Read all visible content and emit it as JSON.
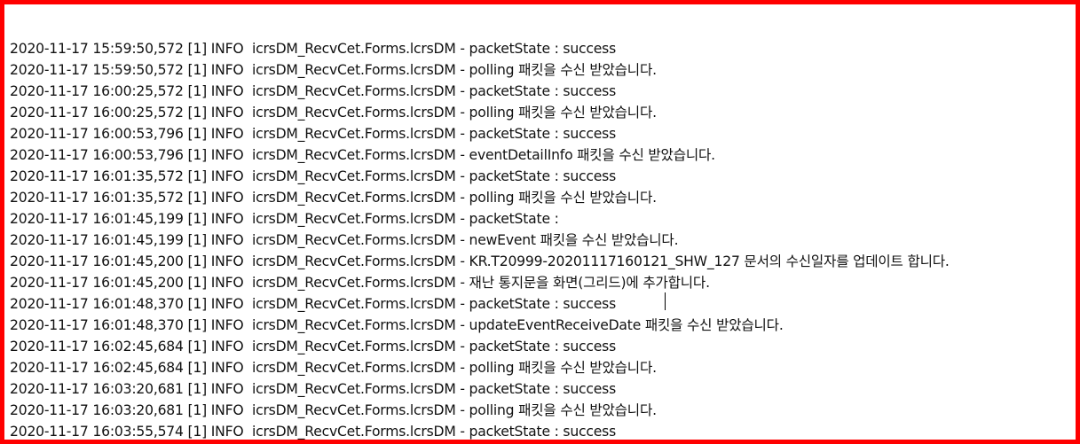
{
  "log": {
    "lines": [
      "2020-11-17 15:59:50,572 [1] INFO  icrsDM_RecvCet.Forms.lcrsDM - packetState : success",
      "2020-11-17 15:59:50,572 [1] INFO  icrsDM_RecvCet.Forms.lcrsDM - polling 패킷을 수신 받았습니다.",
      "2020-11-17 16:00:25,572 [1] INFO  icrsDM_RecvCet.Forms.lcrsDM - packetState : success",
      "2020-11-17 16:00:25,572 [1] INFO  icrsDM_RecvCet.Forms.lcrsDM - polling 패킷을 수신 받았습니다.",
      "2020-11-17 16:00:53,796 [1] INFO  icrsDM_RecvCet.Forms.lcrsDM - packetState : success",
      "2020-11-17 16:00:53,796 [1] INFO  icrsDM_RecvCet.Forms.lcrsDM - eventDetailInfo 패킷을 수신 받았습니다.",
      "2020-11-17 16:01:35,572 [1] INFO  icrsDM_RecvCet.Forms.lcrsDM - packetState : success",
      "2020-11-17 16:01:35,572 [1] INFO  icrsDM_RecvCet.Forms.lcrsDM - polling 패킷을 수신 받았습니다.",
      "2020-11-17 16:01:45,199 [1] INFO  icrsDM_RecvCet.Forms.lcrsDM - packetState :",
      "2020-11-17 16:01:45,199 [1] INFO  icrsDM_RecvCet.Forms.lcrsDM - newEvent 패킷을 수신 받았습니다.",
      "2020-11-17 16:01:45,200 [1] INFO  icrsDM_RecvCet.Forms.lcrsDM - KR.T20999-20201117160121_SHW_127 문서의 수신일자를 업데이트 합니다.",
      "2020-11-17 16:01:45,200 [1] INFO  icrsDM_RecvCet.Forms.lcrsDM - 재난 통지문을 화면(그리드)에 추가합니다.",
      "2020-11-17 16:01:48,370 [1] INFO  icrsDM_RecvCet.Forms.lcrsDM - packetState : success",
      "2020-11-17 16:01:48,370 [1] INFO  icrsDM_RecvCet.Forms.lcrsDM - updateEventReceiveDate 패킷을 수신 받았습니다.",
      "2020-11-17 16:02:45,684 [1] INFO  icrsDM_RecvCet.Forms.lcrsDM - packetState : success",
      "2020-11-17 16:02:45,684 [1] INFO  icrsDM_RecvCet.Forms.lcrsDM - polling 패킷을 수신 받았습니다.",
      "2020-11-17 16:03:20,681 [1] INFO  icrsDM_RecvCet.Forms.lcrsDM - packetState : success",
      "2020-11-17 16:03:20,681 [1] INFO  icrsDM_RecvCet.Forms.lcrsDM - polling 패킷을 수신 받았습니다.",
      "2020-11-17 16:03:55,574 [1] INFO  icrsDM_RecvCet.Forms.lcrsDM - packetState : success"
    ]
  },
  "colors": {
    "highlight_border": "#ff0000",
    "text": "#111111",
    "background": "#ffffff"
  }
}
